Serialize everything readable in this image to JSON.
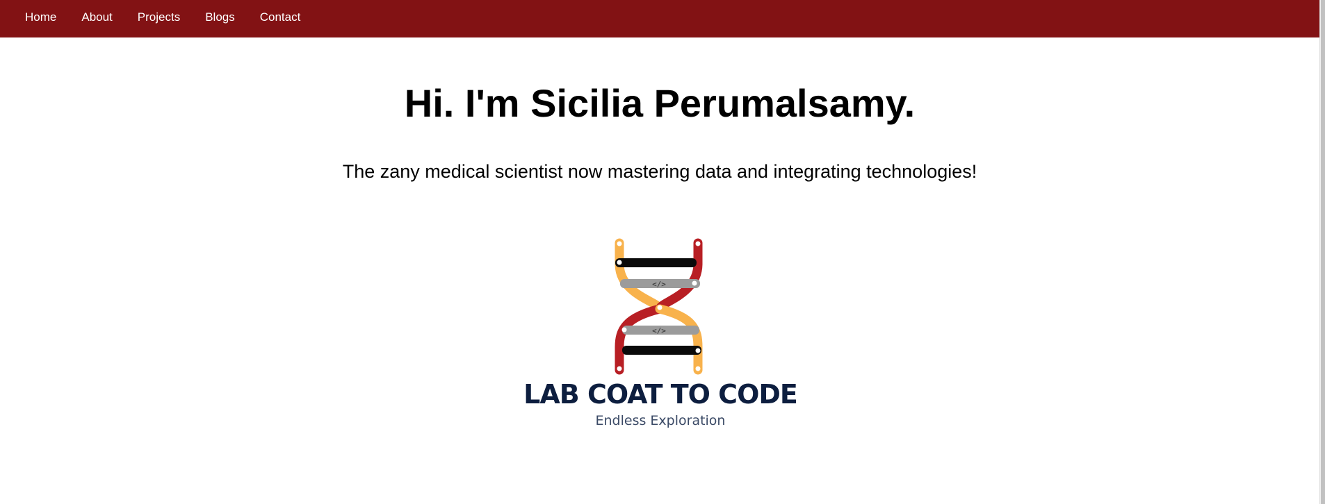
{
  "nav": {
    "items": [
      {
        "label": "Home"
      },
      {
        "label": "About"
      },
      {
        "label": "Projects"
      },
      {
        "label": "Blogs"
      },
      {
        "label": "Contact"
      }
    ]
  },
  "hero": {
    "title": "Hi. I'm Sicilia Perumalsamy.",
    "subtitle": "The zany medical scientist now mastering data and integrating technologies!"
  },
  "logo": {
    "title": "LAB COAT TO CODE",
    "tagline": "Endless Exploration",
    "code_symbol": "</>",
    "icon": "dna-helix-code-icon"
  },
  "colors": {
    "navbar": "#821214",
    "nav_text": "#ffffff",
    "logo_navy": "#0d1e3f",
    "helix_red": "#b81f24",
    "helix_yellow": "#f8b24c",
    "rung_black": "#0a0a0a",
    "rung_gray": "#9b9b9b"
  }
}
